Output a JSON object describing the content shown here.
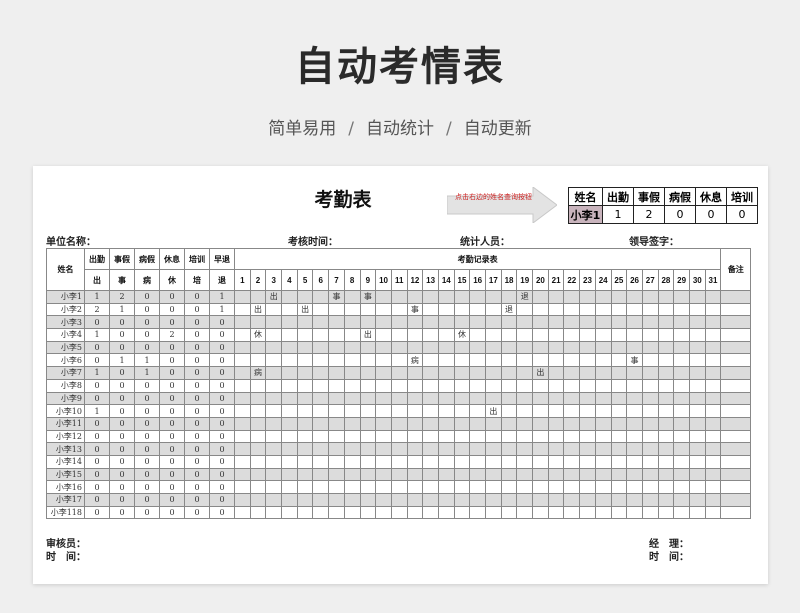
{
  "hero": {
    "title": "自动考情表",
    "subtitle_parts": [
      "简单易用",
      "/",
      "自动统计",
      "/",
      "自动更新"
    ]
  },
  "sheet": {
    "title": "考勤表",
    "hint": "点击右边的姓名查询按钮",
    "query": {
      "headers": [
        "姓名",
        "出勤",
        "事假",
        "病假",
        "休息",
        "培训"
      ],
      "values": [
        "小李1",
        "1",
        "2",
        "0",
        "0",
        "0"
      ]
    },
    "meta": {
      "unit": "单位名称：",
      "period": "考核时间：",
      "stat": "统计人员：",
      "leader": "领导签字："
    },
    "grid": {
      "name_header": "姓名",
      "top_headers": [
        "出勤",
        "事假",
        "病假",
        "休息",
        "培训",
        "早退"
      ],
      "sub_headers": [
        "出",
        "事",
        "病",
        "休",
        "培",
        "退"
      ],
      "record_header": "考勤记录表",
      "remark_header": "备注",
      "days": [
        "1",
        "2",
        "3",
        "4",
        "5",
        "6",
        "7",
        "8",
        "9",
        "10",
        "11",
        "12",
        "13",
        "14",
        "15",
        "16",
        "17",
        "18",
        "19",
        "20",
        "21",
        "22",
        "23",
        "24",
        "25",
        "26",
        "27",
        "28",
        "29",
        "30",
        "31"
      ],
      "rows": [
        {
          "name": "小李1",
          "s": [
            "1",
            "2",
            "0",
            "0",
            "0",
            "1"
          ],
          "marks": {
            "3": "出",
            "7": "事",
            "9": "事",
            "19": "退"
          }
        },
        {
          "name": "小李2",
          "s": [
            "2",
            "1",
            "0",
            "0",
            "0",
            "1"
          ],
          "marks": {
            "2": "出",
            "5": "出",
            "12": "事",
            "18": "退"
          }
        },
        {
          "name": "小李3",
          "s": [
            "0",
            "0",
            "0",
            "0",
            "0",
            "0"
          ],
          "marks": {}
        },
        {
          "name": "小李4",
          "s": [
            "1",
            "0",
            "0",
            "2",
            "0",
            "0"
          ],
          "marks": {
            "2": "休",
            "9": "出",
            "15": "休"
          }
        },
        {
          "name": "小李5",
          "s": [
            "0",
            "0",
            "0",
            "0",
            "0",
            "0"
          ],
          "marks": {}
        },
        {
          "name": "小李6",
          "s": [
            "0",
            "1",
            "1",
            "0",
            "0",
            "0"
          ],
          "marks": {
            "12": "病",
            "26": "事"
          }
        },
        {
          "name": "小李7",
          "s": [
            "1",
            "0",
            "1",
            "0",
            "0",
            "0"
          ],
          "marks": {
            "2": "病",
            "20": "出"
          }
        },
        {
          "name": "小李8",
          "s": [
            "0",
            "0",
            "0",
            "0",
            "0",
            "0"
          ],
          "marks": {}
        },
        {
          "name": "小李9",
          "s": [
            "0",
            "0",
            "0",
            "0",
            "0",
            "0"
          ],
          "marks": {}
        },
        {
          "name": "小李10",
          "s": [
            "1",
            "0",
            "0",
            "0",
            "0",
            "0"
          ],
          "marks": {
            "17": "出"
          }
        },
        {
          "name": "小李11",
          "s": [
            "0",
            "0",
            "0",
            "0",
            "0",
            "0"
          ],
          "marks": {}
        },
        {
          "name": "小李12",
          "s": [
            "0",
            "0",
            "0",
            "0",
            "0",
            "0"
          ],
          "marks": {}
        },
        {
          "name": "小李13",
          "s": [
            "0",
            "0",
            "0",
            "0",
            "0",
            "0"
          ],
          "marks": {}
        },
        {
          "name": "小李14",
          "s": [
            "0",
            "0",
            "0",
            "0",
            "0",
            "0"
          ],
          "marks": {}
        },
        {
          "name": "小李15",
          "s": [
            "0",
            "0",
            "0",
            "0",
            "0",
            "0"
          ],
          "marks": {}
        },
        {
          "name": "小李16",
          "s": [
            "0",
            "0",
            "0",
            "0",
            "0",
            "0"
          ],
          "marks": {}
        },
        {
          "name": "小李17",
          "s": [
            "0",
            "0",
            "0",
            "0",
            "0",
            "0"
          ],
          "marks": {}
        },
        {
          "name": "小李118",
          "s": [
            "0",
            "0",
            "0",
            "0",
            "0",
            "0"
          ],
          "marks": {}
        }
      ]
    },
    "footer": {
      "reviewer": "审核员：",
      "time_left": "时　间：",
      "manager": "经　理：",
      "time_right": "时　间："
    }
  }
}
